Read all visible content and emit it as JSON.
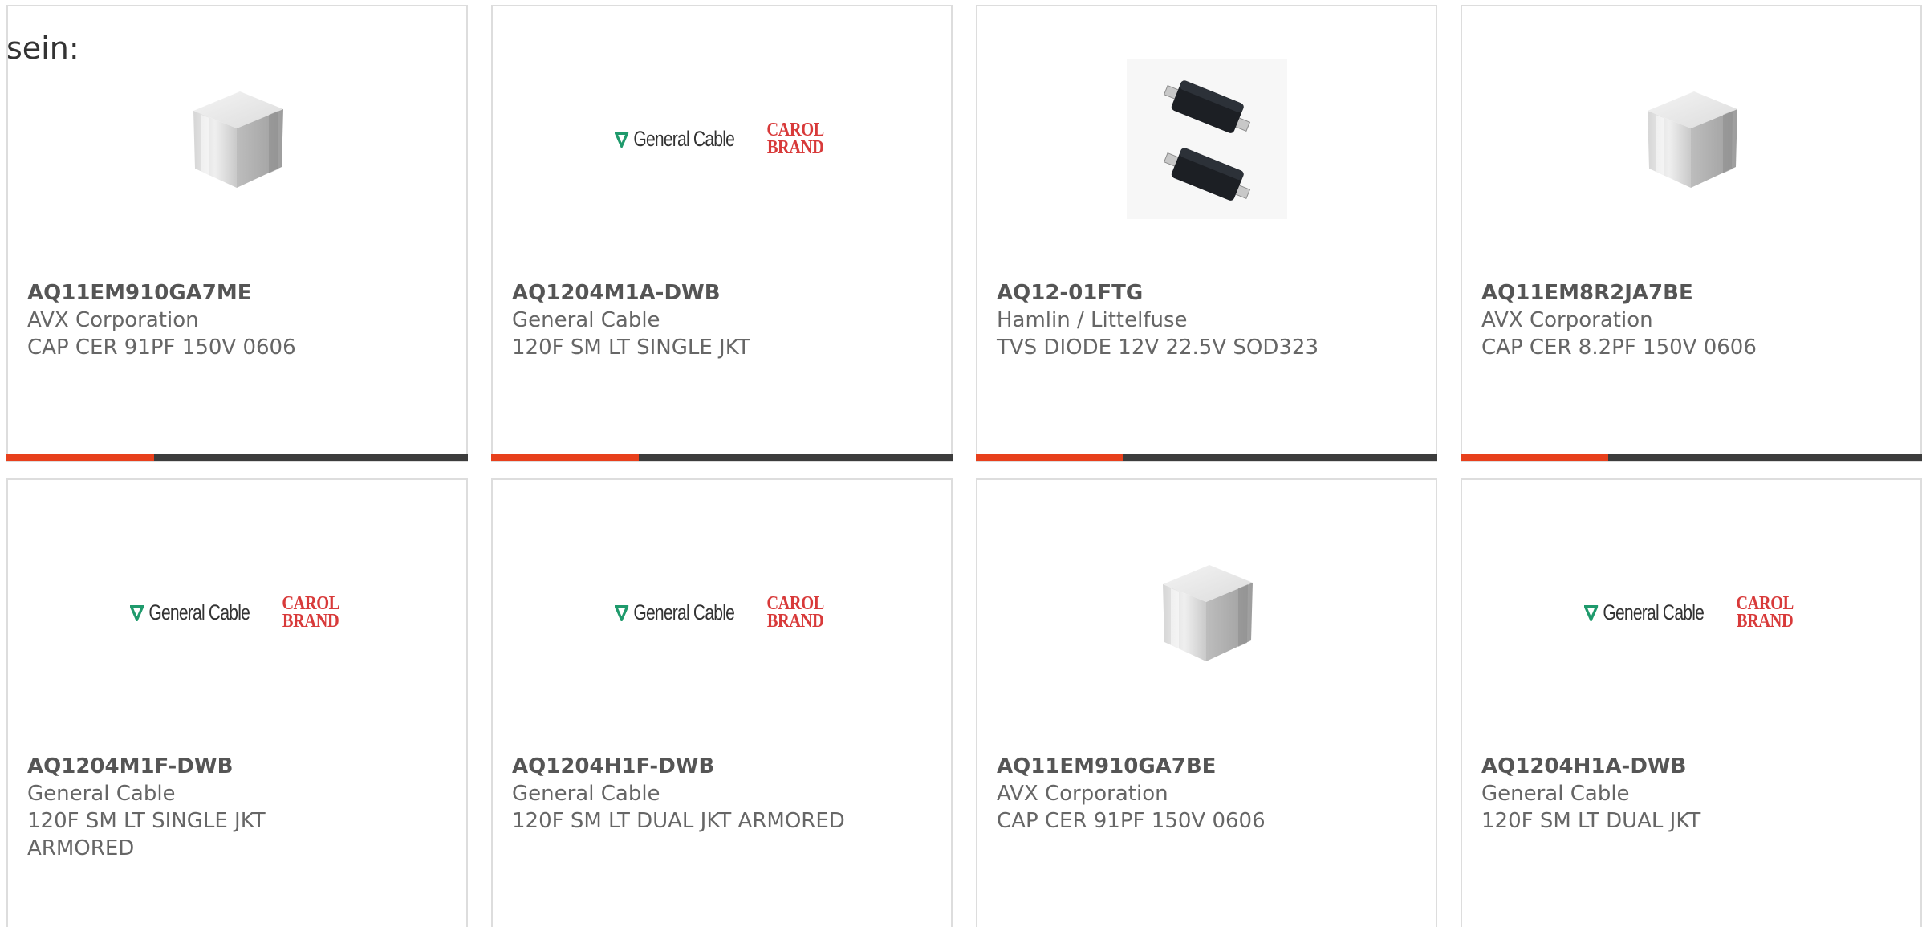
{
  "heading": "sein:",
  "colors": {
    "accent": "#e8401c",
    "bar": "#3c3c3c",
    "logo_red": "#d83a3a",
    "logo_green": "#1f9a6c"
  },
  "products": [
    {
      "part": "AQ11EM910GA7ME",
      "manufacturer": "AVX Corporation",
      "description": "CAP CER 91PF 150V 0606",
      "image": "ceramic-capacitor"
    },
    {
      "part": "AQ1204M1A-DWB",
      "manufacturer": "General Cable",
      "description": "120F SM LT SINGLE JKT",
      "image": "general-cable-logo"
    },
    {
      "part": "AQ12-01FTG",
      "manufacturer": "Hamlin / Littelfuse",
      "description": "TVS DIODE 12V 22.5V SOD323",
      "image": "sod323-diode"
    },
    {
      "part": "AQ11EM8R2JA7BE",
      "manufacturer": "AVX Corporation",
      "description": "CAP CER 8.2PF 150V 0606",
      "image": "ceramic-capacitor"
    },
    {
      "part": "AQ1204M1F-DWB",
      "manufacturer": "General Cable",
      "description": "120F SM LT SINGLE JKT ARMORED",
      "image": "general-cable-logo"
    },
    {
      "part": "AQ1204H1F-DWB",
      "manufacturer": "General Cable",
      "description": "120F SM LT DUAL JKT ARMORED",
      "image": "general-cable-logo"
    },
    {
      "part": "AQ11EM910GA7BE",
      "manufacturer": "AVX Corporation",
      "description": "CAP CER 91PF 150V 0606",
      "image": "ceramic-capacitor"
    },
    {
      "part": "AQ1204H1A-DWB",
      "manufacturer": "General Cable",
      "description": "120F SM LT DUAL JKT",
      "image": "general-cable-logo"
    }
  ],
  "logo": {
    "name": "General Cable",
    "brand_line1": "CAROL",
    "brand_line2": "BRAND"
  }
}
